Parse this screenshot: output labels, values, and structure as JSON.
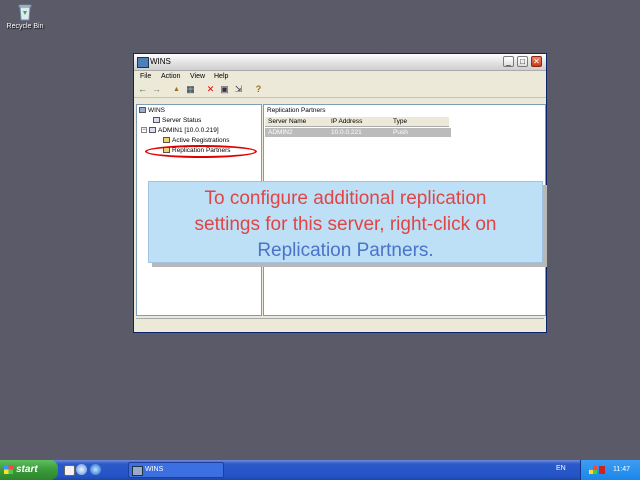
{
  "desktop": {
    "recycle_bin_label": "Recycle Bin"
  },
  "window": {
    "title": "WINS",
    "min_glyph": "_",
    "max_glyph": "□",
    "close_glyph": "✕"
  },
  "menu": {
    "file": "File",
    "action": "Action",
    "view": "View",
    "help": "Help"
  },
  "toolbar": {
    "back": "←",
    "forward": "→",
    "up": "▲",
    "show_hide": "▦",
    "delete": "✕",
    "properties": "▣",
    "export": "⇲",
    "help": "?"
  },
  "tree": {
    "root": "WINS",
    "server_status": "Server Status",
    "server": "ADMIN1 [10.0.0.219]",
    "active_registrations": "Active Registrations",
    "replication_partners": "Replication Partners",
    "expand_glyph": "−"
  },
  "details": {
    "title": "Replication Partners",
    "columns": [
      "Server Name",
      "IP Address",
      "Type"
    ],
    "rows": [
      {
        "server_name": "ADMIN2",
        "ip_address": "10.0.0.221",
        "type": "Push"
      }
    ]
  },
  "callout": {
    "line1": "To configure additional replication",
    "line2": "settings for this server, right-click on",
    "line3": "Replication Partners."
  },
  "taskbar": {
    "start_label": "start",
    "task_label": "WINS",
    "language": "EN",
    "clock": "11:47"
  }
}
